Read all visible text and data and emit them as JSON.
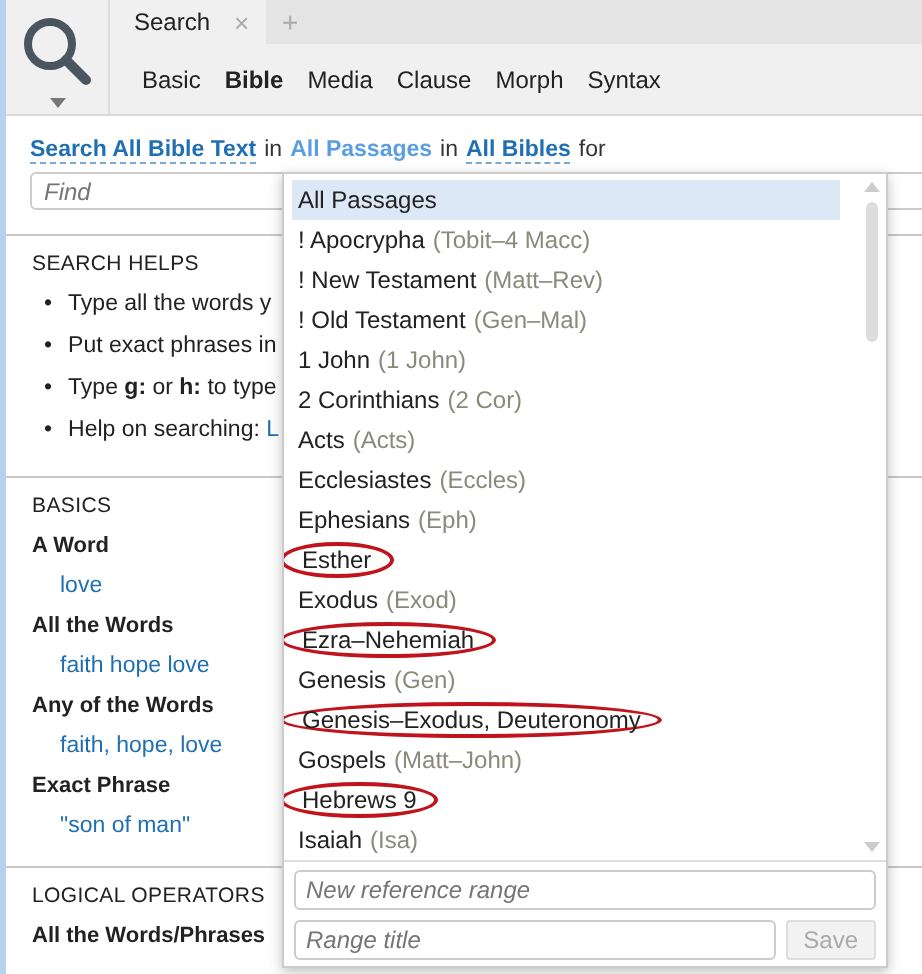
{
  "doc_tab": {
    "title": "Search",
    "close": "×",
    "add": "+"
  },
  "search_tabs": [
    {
      "label": "Basic",
      "selected": false
    },
    {
      "label": "Bible",
      "selected": true
    },
    {
      "label": "Media",
      "selected": false
    },
    {
      "label": "Clause",
      "selected": false
    },
    {
      "label": "Morph",
      "selected": false
    },
    {
      "label": "Syntax",
      "selected": false
    }
  ],
  "query": [
    {
      "text": "Search All Bible Text",
      "kind": "option"
    },
    {
      "text": "in",
      "kind": "plain"
    },
    {
      "text": "All Passages",
      "kind": "range"
    },
    {
      "text": "in",
      "kind": "plain"
    },
    {
      "text": "All Bibles",
      "kind": "option"
    },
    {
      "text": "for",
      "kind": "plain"
    }
  ],
  "find": {
    "placeholder": "Find"
  },
  "search_helps": {
    "heading": "SEARCH HELPS",
    "marker": "•",
    "bullets": [
      "Type all the words y",
      "Put exact phrases in",
      "Type **g:** or **h:** to type"
    ],
    "help": {
      "text": "Help on searching:",
      "link": "L"
    }
  },
  "basics": {
    "heading": "BASICS",
    "examples": [
      {
        "title": "A Word",
        "query": "love"
      },
      {
        "title": "All the Words",
        "query": "faith hope love"
      },
      {
        "title": "Any of the Words",
        "query": "faith, hope, love"
      },
      {
        "title": "Exact Phrase",
        "query": "\"son of man\""
      }
    ]
  },
  "logical_operators": {
    "heading": "LOGICAL OPERATORS",
    "first": "All the Words/Phrases"
  },
  "passages_menu": {
    "items": [
      {
        "name": "All Passages",
        "selected": true,
        "circled": false
      },
      {
        "name": "! Apocrypha",
        "range": "(Tobit–4 Macc)",
        "selected": false,
        "circled": false
      },
      {
        "name": "! New Testament",
        "range": "(Matt–Rev)",
        "selected": false,
        "circled": false
      },
      {
        "name": "! Old Testament",
        "range": "(Gen–Mal)",
        "selected": false,
        "circled": false
      },
      {
        "name": "1 John",
        "range": "(1 John)",
        "selected": false,
        "circled": false
      },
      {
        "name": "2 Corinthians",
        "range": "(2 Cor)",
        "selected": false,
        "circled": false
      },
      {
        "name": "Acts",
        "range": "(Acts)",
        "selected": false,
        "circled": false
      },
      {
        "name": "Ecclesiastes",
        "range": "(Eccles)",
        "selected": false,
        "circled": false
      },
      {
        "name": "Ephesians",
        "range": "(Eph)",
        "selected": false,
        "circled": false
      },
      {
        "name": "Esther",
        "selected": false,
        "circled": true
      },
      {
        "name": "Exodus",
        "range": "(Exod)",
        "selected": false,
        "circled": false
      },
      {
        "name": "Ezra–Nehemiah",
        "selected": false,
        "circled": true
      },
      {
        "name": "Genesis",
        "range": "(Gen)",
        "selected": false,
        "circled": false
      },
      {
        "name": "Genesis–Exodus, Deuteronomy",
        "selected": false,
        "circled": true
      },
      {
        "name": "Gospels",
        "range": "(Matt–John)",
        "selected": false,
        "circled": false
      },
      {
        "name": "Hebrews 9",
        "selected": false,
        "circled": true
      },
      {
        "name": "Isaiah",
        "range": "(Isa)",
        "selected": false,
        "circled": false
      }
    ],
    "new_range": {
      "placeholder": "New reference range"
    },
    "range_title": {
      "placeholder": "Range title"
    },
    "save": "Save"
  }
}
